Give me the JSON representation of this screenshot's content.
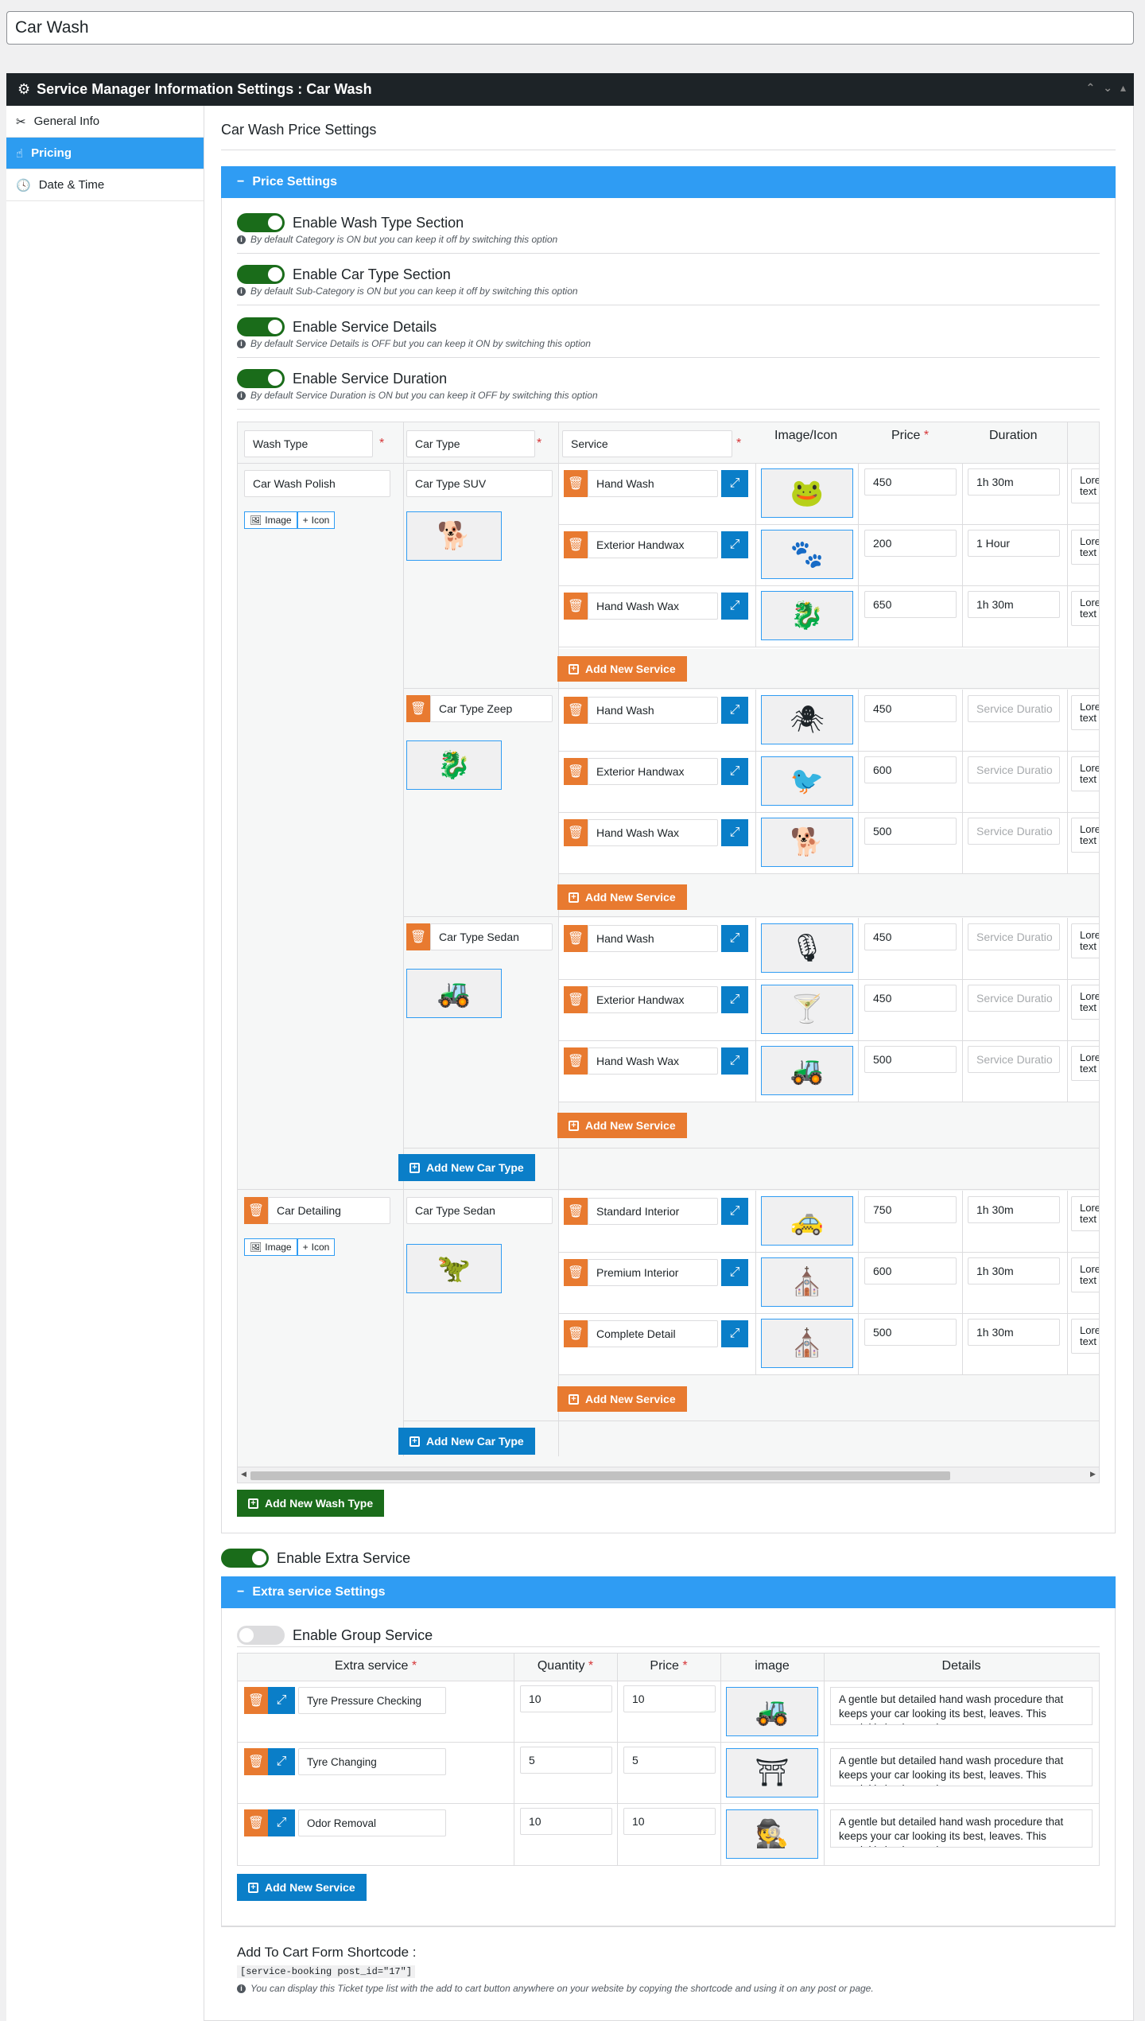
{
  "post_title": "Car Wash",
  "metabox": {
    "title": "Service Manager Information Settings : Car Wash"
  },
  "nav": [
    {
      "label": "General Info",
      "icon": "tools-icon"
    },
    {
      "label": "Pricing",
      "icon": "pricing-icon"
    },
    {
      "label": "Date & Time",
      "icon": "clock-icon"
    }
  ],
  "content_title": "Car Wash Price Settings",
  "price_settings": {
    "header": "Price Settings",
    "toggles": [
      {
        "label": "Enable Wash Type Section",
        "hint": "By default Category is ON but you can keep it off by switching this option",
        "on": true
      },
      {
        "label": "Enable Car Type Section",
        "hint": "By default Sub-Category is ON but you can keep it off by switching this option",
        "on": true
      },
      {
        "label": "Enable Service Details",
        "hint": "By default Service Details is OFF but you can keep it ON by switching this option",
        "on": true
      },
      {
        "label": "Enable Service Duration",
        "hint": "By default Service Duration is ON but you can keep it OFF by switching this option",
        "on": true
      }
    ],
    "headers": {
      "wash_type": "Wash Type",
      "car_type": "Car Type",
      "service": "Service",
      "image_icon": "Image/Icon",
      "price": "Price",
      "duration": "Duration",
      "req": "*"
    },
    "details_clip": [
      "Lore",
      "text"
    ],
    "duration_placeholder": "Service Duratio",
    "image_btn": "Image",
    "icon_btn": "Icon",
    "add_service": "Add New Service",
    "add_car_type": "Add New Car Type",
    "add_wash_type": "Add New Wash Type",
    "wash_types": [
      {
        "name": "Car Wash Polish"
      },
      {
        "name": "Car Detailing"
      }
    ],
    "car_types": [
      {
        "name": "Car Type SUV",
        "icon": "🐕"
      },
      {
        "name": "Car Type Zeep",
        "icon": "🐉"
      },
      {
        "name": "Car Type Sedan",
        "icon": "🚜"
      },
      {
        "name": "Car Type Sedan",
        "icon": "🦖"
      }
    ],
    "services": [
      {
        "name": "Hand Wash",
        "icon": "🐸",
        "price": "450",
        "duration": "1h 30m"
      },
      {
        "name": "Exterior Handwax",
        "icon": "🐾",
        "price": "200",
        "duration": "1 Hour"
      },
      {
        "name": "Hand Wash Wax",
        "icon": "🐉",
        "price": "650",
        "duration": "1h 30m"
      },
      {
        "name": "Hand Wash",
        "icon": "🕷",
        "price": "450",
        "duration": ""
      },
      {
        "name": "Exterior Handwax",
        "icon": "🐦",
        "price": "600",
        "duration": ""
      },
      {
        "name": "Hand Wash Wax",
        "icon": "🐕",
        "price": "500",
        "duration": ""
      },
      {
        "name": "Hand Wash",
        "icon": "🎙",
        "price": "450",
        "duration": ""
      },
      {
        "name": "Exterior Handwax",
        "icon": "🍸",
        "price": "450",
        "duration": ""
      },
      {
        "name": "Hand Wash Wax",
        "icon": "🚜",
        "price": "500",
        "duration": ""
      },
      {
        "name": "Standard Interior",
        "icon": "🚕",
        "price": "750",
        "duration": "1h 30m"
      },
      {
        "name": "Premium Interior",
        "icon": "⛪",
        "price": "600",
        "duration": "1h 30m"
      },
      {
        "name": "Complete Detail",
        "icon": "⛪",
        "price": "500",
        "duration": "1h 30m"
      }
    ]
  },
  "extra": {
    "enable_label": "Enable Extra Service",
    "header": "Extra service Settings",
    "group_label": "Enable Group Service",
    "headers": {
      "service": "Extra service",
      "quantity": "Quantity",
      "price": "Price",
      "image": "image",
      "details": "Details",
      "req": "*"
    },
    "rows": [
      {
        "name": "Tyre Pressure Checking",
        "qty": "10",
        "price": "10",
        "icon": "🚜",
        "details": "A gentle but detailed hand wash procedure that keeps your car looking its best, leaves. This tutorial is by the wash"
      },
      {
        "name": "Tyre Changing",
        "qty": "5",
        "price": "5",
        "icon": "⛩",
        "details": "A gentle but detailed hand wash procedure that keeps your car looking its best, leaves. This tutorial is by the wash"
      },
      {
        "name": "Odor Removal",
        "qty": "10",
        "price": "10",
        "icon": "🕵",
        "details": "A gentle but detailed hand wash procedure that keeps your car looking its best, leaves. This tutorial is by the wash"
      }
    ],
    "add_service": "Add New Service"
  },
  "shortcode": {
    "title": "Add To Cart Form Shortcode :",
    "code": "[service-booking post_id=\"17\"]",
    "hint": "You can display this Ticket type list with the add to cart button anywhere on your website by copying the shortcode and using it on any post or page."
  },
  "colors": {
    "accent": "#2f9cf3",
    "orange": "#e87a30",
    "blue": "#0a7ec8",
    "green": "#1a6c1a",
    "header_dark": "#1d2327"
  }
}
